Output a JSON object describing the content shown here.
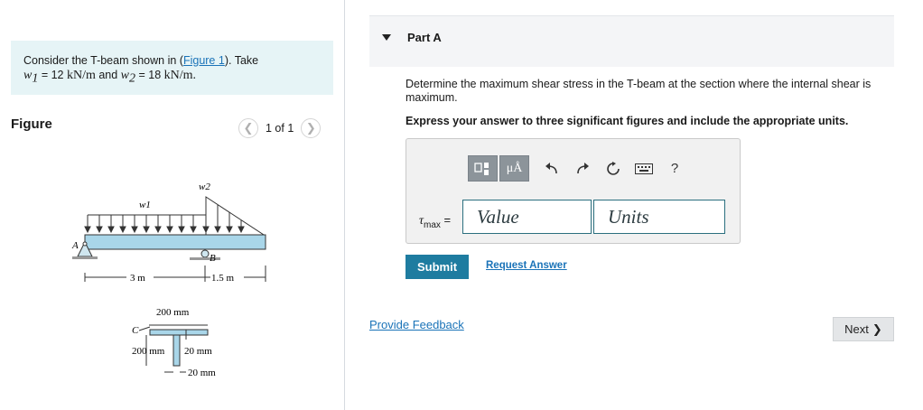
{
  "problem": {
    "intro": "Consider the T-beam shown in (",
    "figure_link": "Figure 1",
    "after_link": "). Take",
    "w1_sym": "w",
    "w1_sub": "1",
    "w1_value": " = 12 ",
    "w1_unit": "kN/m",
    "and": " and ",
    "w2_sym": "w",
    "w2_sub": "2",
    "w2_value": " = 18 ",
    "w2_unit": "kN/m."
  },
  "figure": {
    "title": "Figure",
    "pager_text": "1 of 1",
    "prev_icon": "chevron-left-icon",
    "next_icon": "chevron-right-icon",
    "labels": {
      "w1": "w1",
      "w2": "w2",
      "A": "A",
      "B": "B",
      "C": "C",
      "span1": "3 m",
      "span2": "1.5 m",
      "flange_width": "200 mm",
      "web_depth": "200 mm",
      "flange_thick": "20 mm",
      "web_thick": "20 mm"
    }
  },
  "part": {
    "title": "Part A",
    "question": "Determine the maximum shear stress in the T-beam at the section where the internal shear is maximum.",
    "instruction": "Express your answer to three significant figures and include the appropriate units."
  },
  "toolbar": {
    "template_icon": "template-icon",
    "units_label": "μÅ",
    "undo_icon": "undo-icon",
    "redo_icon": "redo-icon",
    "reset_icon": "reset-icon",
    "keyboard_icon": "keyboard-icon",
    "help_label": "?"
  },
  "answer": {
    "tau_sym": "τ",
    "tau_sub": "max",
    "equals": " =",
    "value_placeholder": "Value",
    "units_placeholder": "Units"
  },
  "actions": {
    "submit": "Submit",
    "request_answer": "Request Answer",
    "provide_feedback": "Provide Feedback",
    "next": "Next",
    "next_chevron": "❯"
  }
}
